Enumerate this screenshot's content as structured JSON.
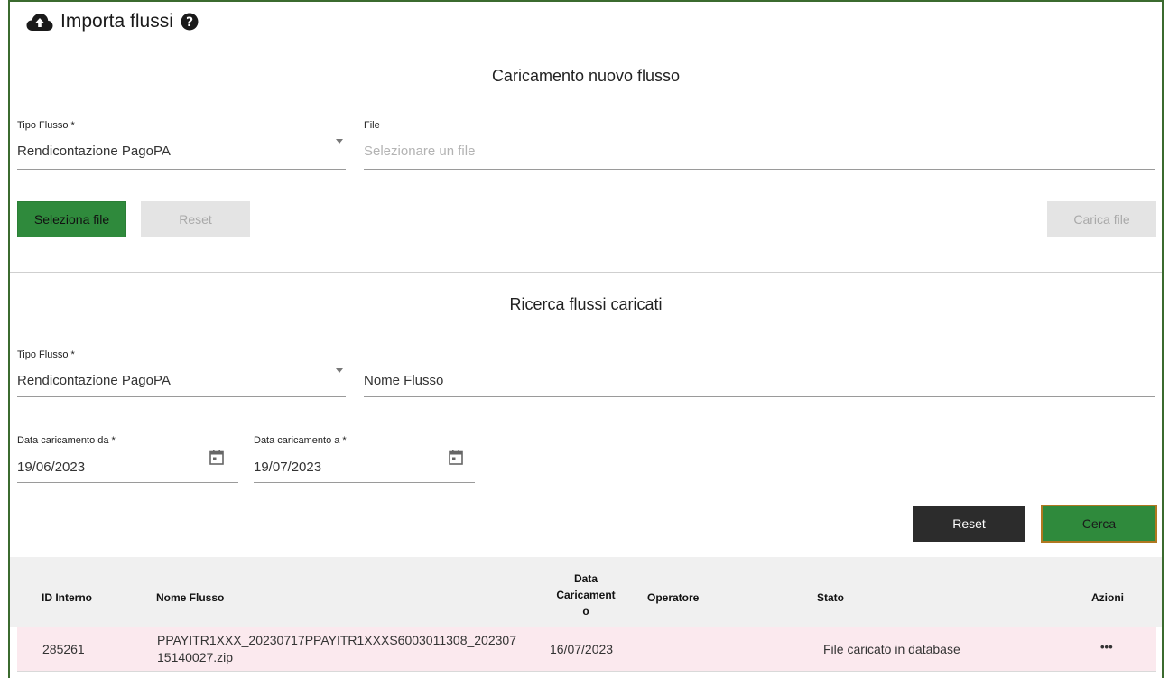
{
  "page": {
    "title": "Importa flussi"
  },
  "upload": {
    "section_title": "Caricamento nuovo flusso",
    "tipo_flusso_label": "Tipo Flusso *",
    "tipo_flusso_value": "Rendicontazione PagoPA",
    "file_label": "File",
    "file_placeholder": "Selezionare un file",
    "select_file_button": "Seleziona file",
    "reset_button": "Reset",
    "upload_button": "Carica file"
  },
  "search": {
    "section_title": "Ricerca flussi caricati",
    "tipo_flusso_label": "Tipo Flusso *",
    "tipo_flusso_value": "Rendicontazione PagoPA",
    "nome_flusso_placeholder": "Nome Flusso",
    "date_from_label": "Data caricamento da *",
    "date_from_value": "19/06/2023",
    "date_to_label": "Data caricamento a *",
    "date_to_value": "19/07/2023",
    "reset_button": "Reset",
    "search_button": "Cerca"
  },
  "table": {
    "headers": {
      "id": "ID Interno",
      "nome": "Nome Flusso",
      "data_line1": "Data",
      "data_line2": "Caricament",
      "data_line3": "o",
      "operatore": "Operatore",
      "stato": "Stato",
      "azioni": "Azioni"
    },
    "rows": [
      {
        "id": "285261",
        "nome_line1": "PPAYITR1XXX_20230717PPAYITR1XXXS6003011308_202307",
        "nome_line2": "15140027.zip",
        "data": "16/07/2023",
        "operatore": "",
        "stato": "File caricato in database",
        "azioni": "•••"
      }
    ]
  },
  "colors": {
    "accent_green": "#2f8a3c",
    "frame_border": "#3b6b2f",
    "row_highlight": "#fbe9ee"
  }
}
